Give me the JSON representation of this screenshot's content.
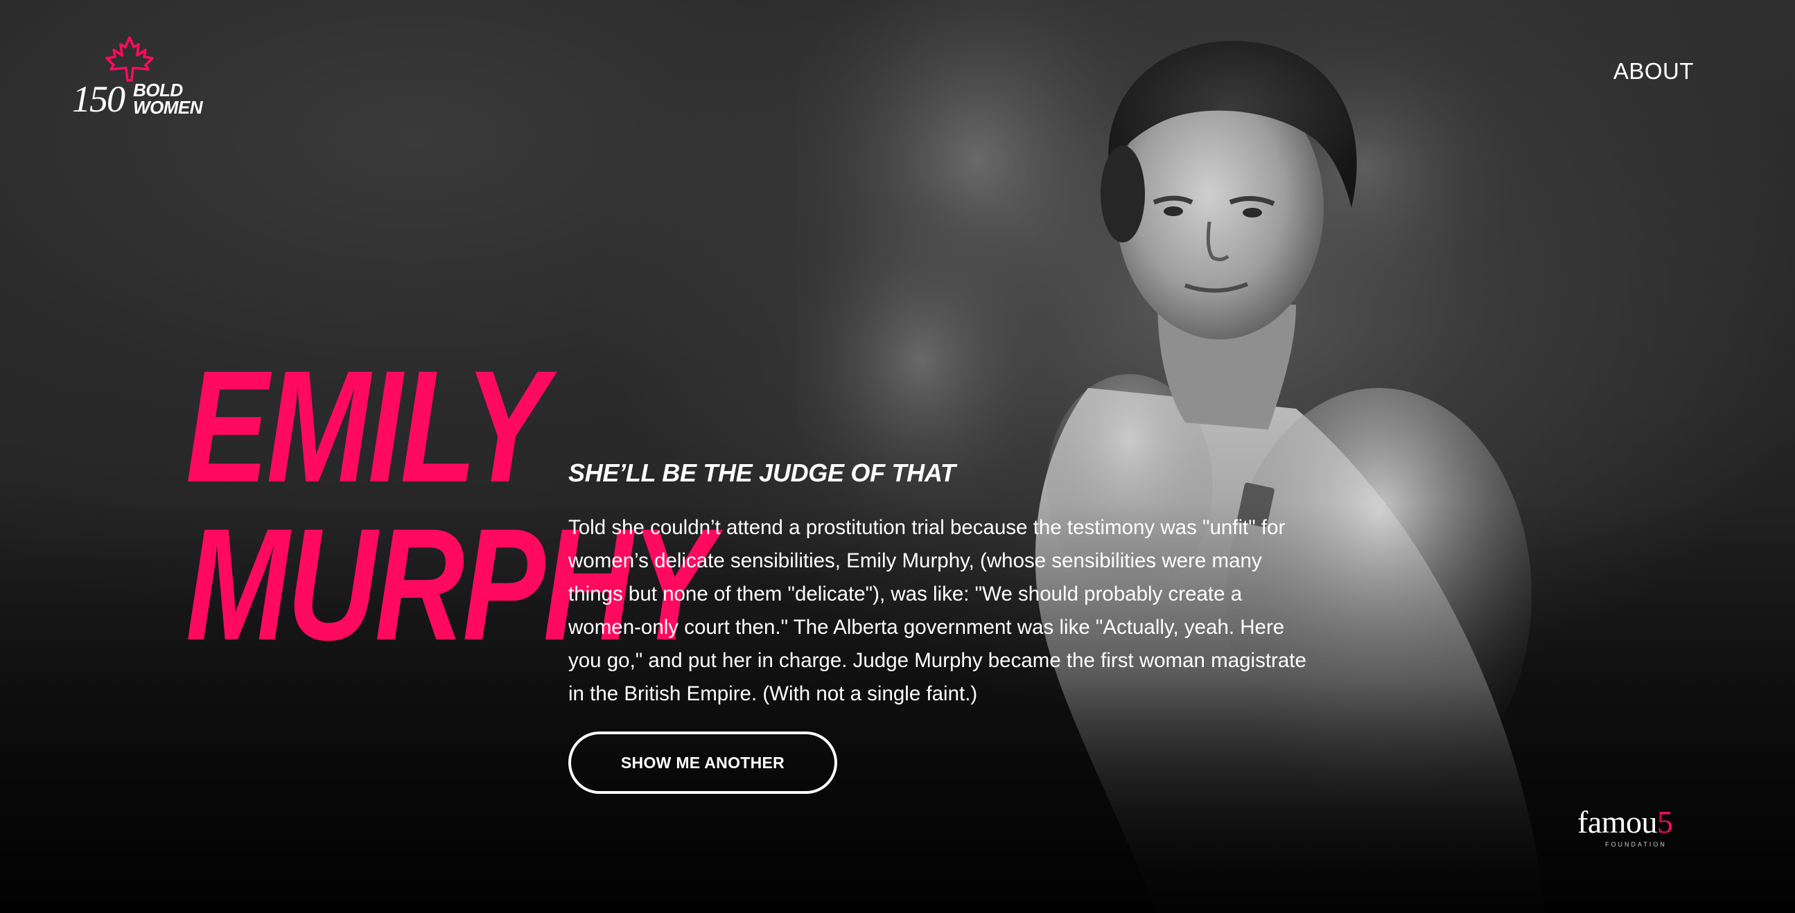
{
  "header": {
    "logo": {
      "number": "150",
      "line1": "BOLD",
      "line2": "WOMEN",
      "icon": "maple-leaf-icon"
    },
    "nav": {
      "about_label": "ABOUT"
    }
  },
  "hero": {
    "first_name": "EMILY",
    "last_name": "MURPHY",
    "tagline": "SHE’LL BE THE JUDGE OF THAT",
    "bio": "Told she couldn’t attend a prostitution trial because the testimony was \"unfit\" for women’s delicate sensibilities, Emily Murphy, (whose sensibilities were many things but none of them \"delicate\"), was like: \"We should probably create a women-only court then.\" The Alberta government was like \"Actually, yeah. Here you go,\" and put her in charge. Judge Murphy became the first woman magistrate in the British Empire. (With not a single faint.)",
    "cta_label": "SHOW ME ANOTHER",
    "portrait": "historical-portrait-photo"
  },
  "footer": {
    "partner_wordmark_main": "famou",
    "partner_wordmark_accent": "5",
    "partner_sub": "FOUNDATION"
  },
  "colors": {
    "accent": "#ff0a5f",
    "text": "#ffffff",
    "background": "#1c1c1c"
  }
}
